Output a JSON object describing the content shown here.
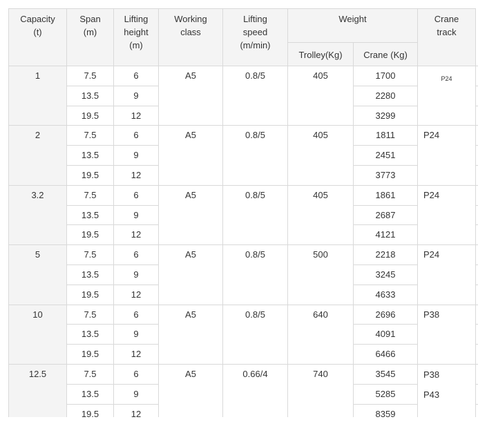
{
  "headers": {
    "capacity": "Capacity\n(t)",
    "span": "Span\n(m)",
    "lifting_height": "Lifting\nheight\n(m)",
    "working_class": "Working\nclass",
    "lifting_speed": "Lifting\nspeed\n(m/min)",
    "weight": "Weight",
    "crane_track": "Crane\ntrack",
    "trolley": "Trolley(Kg)",
    "crane": "Crane (Kg)"
  },
  "groups": [
    {
      "capacity": "1",
      "working_class": "A5",
      "lifting_speed": "0.8/5",
      "trolley": "405",
      "crane_track": "P24",
      "rows": [
        {
          "span": "7.5",
          "height": "6",
          "crane": "1700"
        },
        {
          "span": "13.5",
          "height": "9",
          "crane": "2280"
        },
        {
          "span": "19.5",
          "height": "12",
          "crane": "3299"
        }
      ]
    },
    {
      "capacity": "2",
      "working_class": "A5",
      "lifting_speed": "0.8/5",
      "trolley": "405",
      "crane_track": "P24",
      "rows": [
        {
          "span": "7.5",
          "height": "6",
          "crane": "1811"
        },
        {
          "span": "13.5",
          "height": "9",
          "crane": "2451"
        },
        {
          "span": "19.5",
          "height": "12",
          "crane": "3773"
        }
      ]
    },
    {
      "capacity": "3.2",
      "working_class": "A5",
      "lifting_speed": "0.8/5",
      "trolley": "405",
      "crane_track": "P24",
      "rows": [
        {
          "span": "7.5",
          "height": "6",
          "crane": "1861"
        },
        {
          "span": "13.5",
          "height": "9",
          "crane": "2687"
        },
        {
          "span": "19.5",
          "height": "12",
          "crane": "4121"
        }
      ]
    },
    {
      "capacity": "5",
      "working_class": "A5",
      "lifting_speed": "0.8/5",
      "trolley": "500",
      "crane_track": "P24",
      "rows": [
        {
          "span": "7.5",
          "height": "6",
          "crane": "2218"
        },
        {
          "span": "13.5",
          "height": "9",
          "crane": "3245"
        },
        {
          "span": "19.5",
          "height": "12",
          "crane": "4633"
        }
      ]
    },
    {
      "capacity": "10",
      "working_class": "A5",
      "lifting_speed": "0.8/5",
      "trolley": "640",
      "crane_track": "P38",
      "rows": [
        {
          "span": "7.5",
          "height": "6",
          "crane": "2696"
        },
        {
          "span": "13.5",
          "height": "9",
          "crane": "4091"
        },
        {
          "span": "19.5",
          "height": "12",
          "crane": "6466"
        }
      ]
    },
    {
      "capacity": "12.5",
      "working_class": "A5",
      "lifting_speed": "0.66/4",
      "trolley": "740",
      "crane_track": "P38\nP43",
      "rows": [
        {
          "span": "7.5",
          "height": "6",
          "crane": "3545"
        },
        {
          "span": "13.5",
          "height": "9",
          "crane": "5285"
        },
        {
          "span": "19.5",
          "height": "12",
          "crane": "8359"
        }
      ]
    }
  ]
}
